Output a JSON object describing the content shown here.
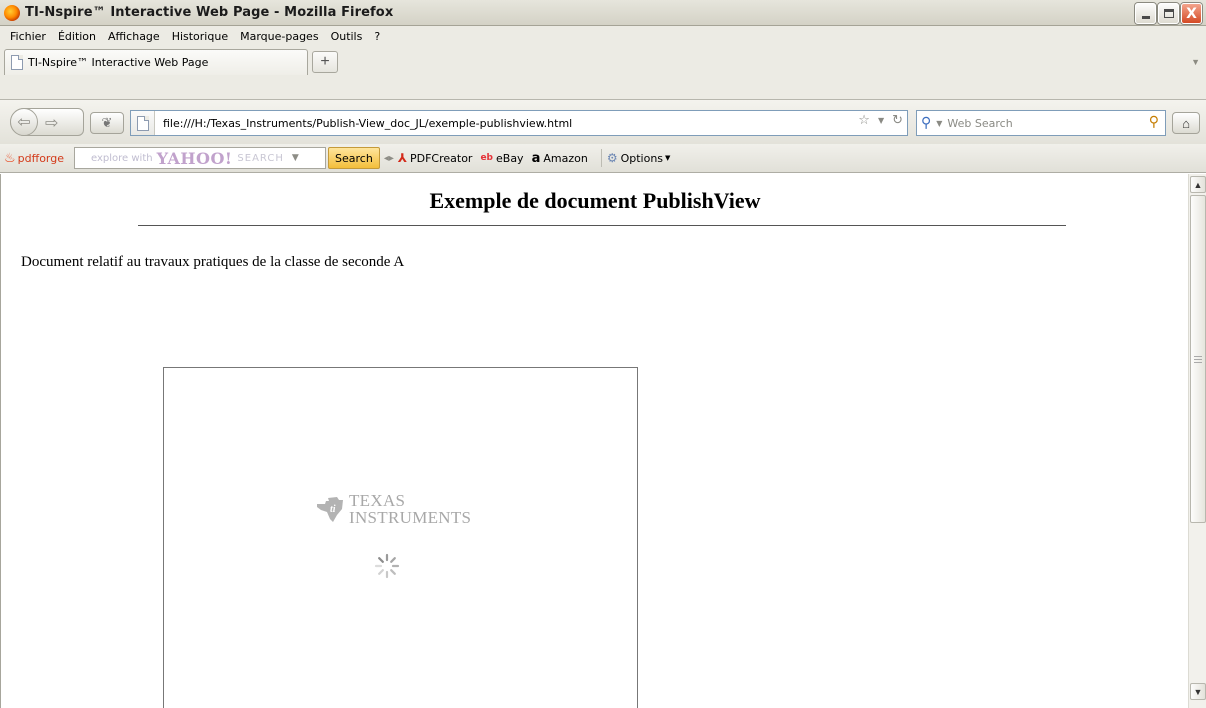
{
  "window": {
    "title": "TI-Nspire™ Interactive Web Page - Mozilla Firefox",
    "controls": {
      "minimize": "",
      "maximize": "",
      "close": "X"
    }
  },
  "menu": {
    "items": [
      "Fichier",
      "Édition",
      "Affichage",
      "Historique",
      "Marque-pages",
      "Outils",
      "?"
    ]
  },
  "tabs": {
    "active_label": "TI-Nspire™ Interactive Web Page",
    "new_tab_label": "+"
  },
  "navigation": {
    "url": "file:///H:/Texas_Instruments/Publish-View_doc_JL/exemple-publishview.html",
    "search_placeholder": "Web Search"
  },
  "toolbar": {
    "brand": "pdfforge",
    "yahoo_hint": "explore with",
    "yahoo_logo": "YAHOO!",
    "yahoo_search": "SEARCH",
    "search_button": "Search",
    "links": [
      "PDFCreator",
      "eBay",
      "Amazon",
      "Options"
    ]
  },
  "page": {
    "heading": "Exemple de document PublishView",
    "body_text": "Document relatif au travaux pratiques de la classe de seconde A"
  },
  "nspire_frame": {
    "logo_line1": "TEXAS",
    "logo_line2": "INSTRUMENTS"
  },
  "colors": {
    "chrome_bg": "#ecebe4",
    "url_border": "#7f9db9",
    "search_button": "#f3be3b",
    "logo_gray": "#a8a8a8"
  }
}
